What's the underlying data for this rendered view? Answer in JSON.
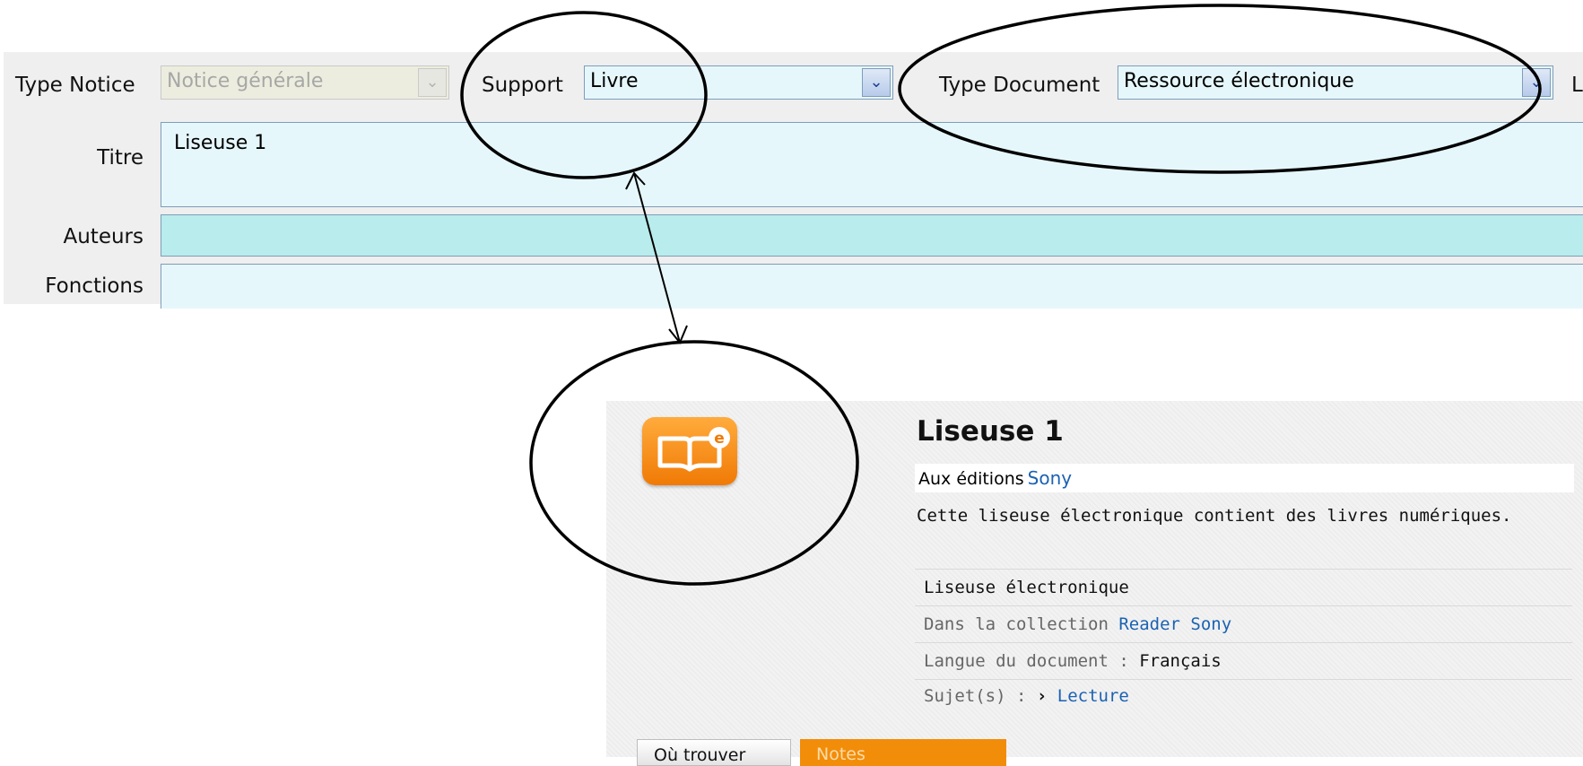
{
  "form": {
    "type_notice_label": "Type Notice",
    "type_notice_value": "Notice générale",
    "support_label": "Support",
    "support_value": "Livre",
    "type_document_label": "Type Document",
    "type_document_value": "Ressource électronique",
    "cut_label": "L",
    "titre_label": "Titre",
    "titre_value": "Liseuse 1",
    "auteurs_label": "Auteurs",
    "auteurs_value": "",
    "fonctions_label": "Fonctions",
    "fonctions_value": ""
  },
  "record": {
    "icon": "ebook-icon",
    "title": "Liseuse 1",
    "publisher_prefix": "Aux éditions",
    "publisher_name": "Sony",
    "description": "Cette liseuse électronique contient des livres numériques.",
    "type_line": "Liseuse électronique",
    "collection_prefix": "Dans la collection",
    "collection_name": "Reader Sony",
    "language_label": "Langue du document :",
    "language_value": "Français",
    "subjects_label": "Sujet(s) :",
    "subject_bullet": "›",
    "subject_value": "Lecture",
    "where_button": "Où trouver",
    "notes_button": "Notes"
  },
  "colors": {
    "field_bg": "#e6f7fc",
    "authors_bg": "#b9ecec",
    "link": "#1b62b3",
    "accent_orange": "#f28d0a"
  }
}
